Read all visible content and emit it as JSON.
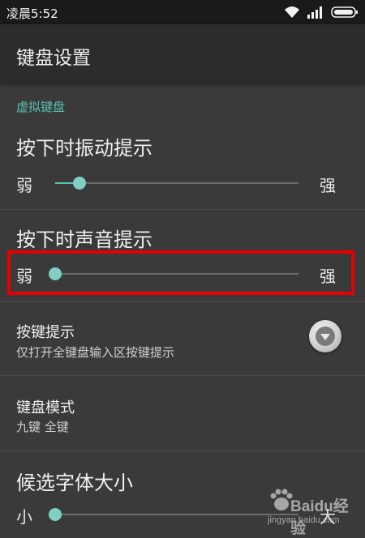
{
  "status_bar": {
    "time": "凌晨5:52",
    "icons": [
      "wifi-icon",
      "signal-icon",
      "battery-icon"
    ]
  },
  "action_bar": {
    "title": "键盘设置"
  },
  "section": {
    "header": "虚拟键盘"
  },
  "vibration": {
    "title": "按下时振动提示",
    "weak": "弱",
    "strong": "强",
    "level": 0.1
  },
  "sound": {
    "title": "按下时声音提示",
    "weak": "弱",
    "strong": "强",
    "level": 0.0
  },
  "key_hint": {
    "title": "按键提示",
    "summary": "仅打开全键盘输入区按键提示",
    "icon": "dropdown-toggle-icon"
  },
  "keyboard_mode": {
    "title": "键盘模式",
    "summary": "九键 全键"
  },
  "font_size": {
    "title": "候选字体大小",
    "small": "小",
    "large": "大",
    "level": 0.0
  },
  "watermark": {
    "logo": "Baidu经验",
    "url": "jingyan.baidu.com"
  },
  "colors": {
    "accent": "#5bc0b3",
    "highlight": "#e60000",
    "background": "#3a3a3a"
  }
}
